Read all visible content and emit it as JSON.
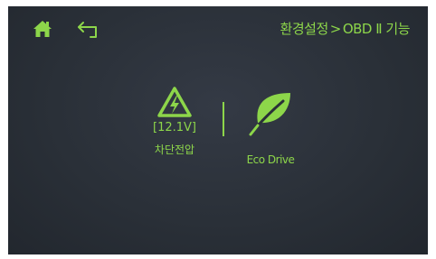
{
  "header": {
    "home_icon": "home-icon",
    "back_icon": "back-arrow-icon",
    "breadcrumb": {
      "parent": "환경설정",
      "separator": ">",
      "current": "OBD Ⅱ 기능"
    }
  },
  "menu": {
    "cutoff": {
      "icon": "warning-lightning-icon",
      "voltage": "[12.1V]",
      "label": "차단전압"
    },
    "eco": {
      "icon": "leaf-icon",
      "label": "Eco Drive"
    }
  },
  "colors": {
    "accent": "#8dd64a",
    "background": "#2a3038"
  }
}
